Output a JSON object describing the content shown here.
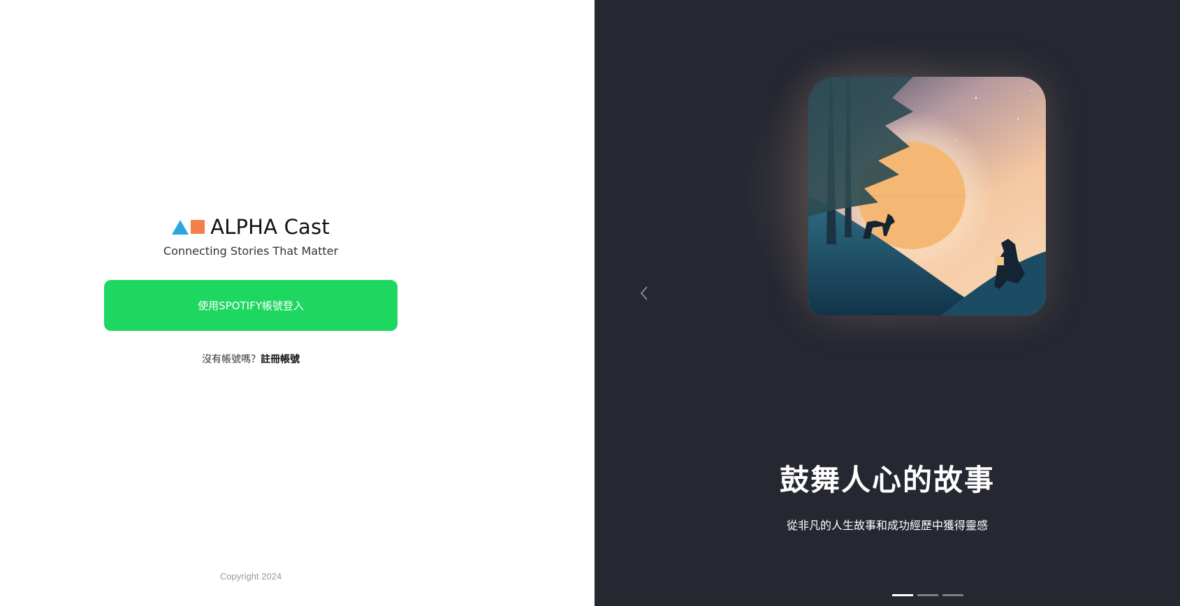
{
  "brand": {
    "name": "ALPHA Cast",
    "tagline": "Connecting Stories That Matter",
    "colors": {
      "triangle": "#2da6e0",
      "square": "#f57e4d"
    }
  },
  "login": {
    "spotify_button_label": "使用SPOTIFY帳號登入",
    "spotify_color": "#1ed760",
    "no_account_text": "沒有帳號嗎？",
    "signup_link_label": "註冊帳號"
  },
  "footer": {
    "copyright": "Copyright 2024"
  },
  "carousel": {
    "title": "鼓舞人心的故事",
    "subtitle": "從非凡的人生故事和成功經歷中獲得靈感",
    "prev_icon": "chevron-left-icon",
    "slide_count": 3,
    "active_index": 0
  },
  "colors": {
    "right_panel_bg": "#252731"
  }
}
